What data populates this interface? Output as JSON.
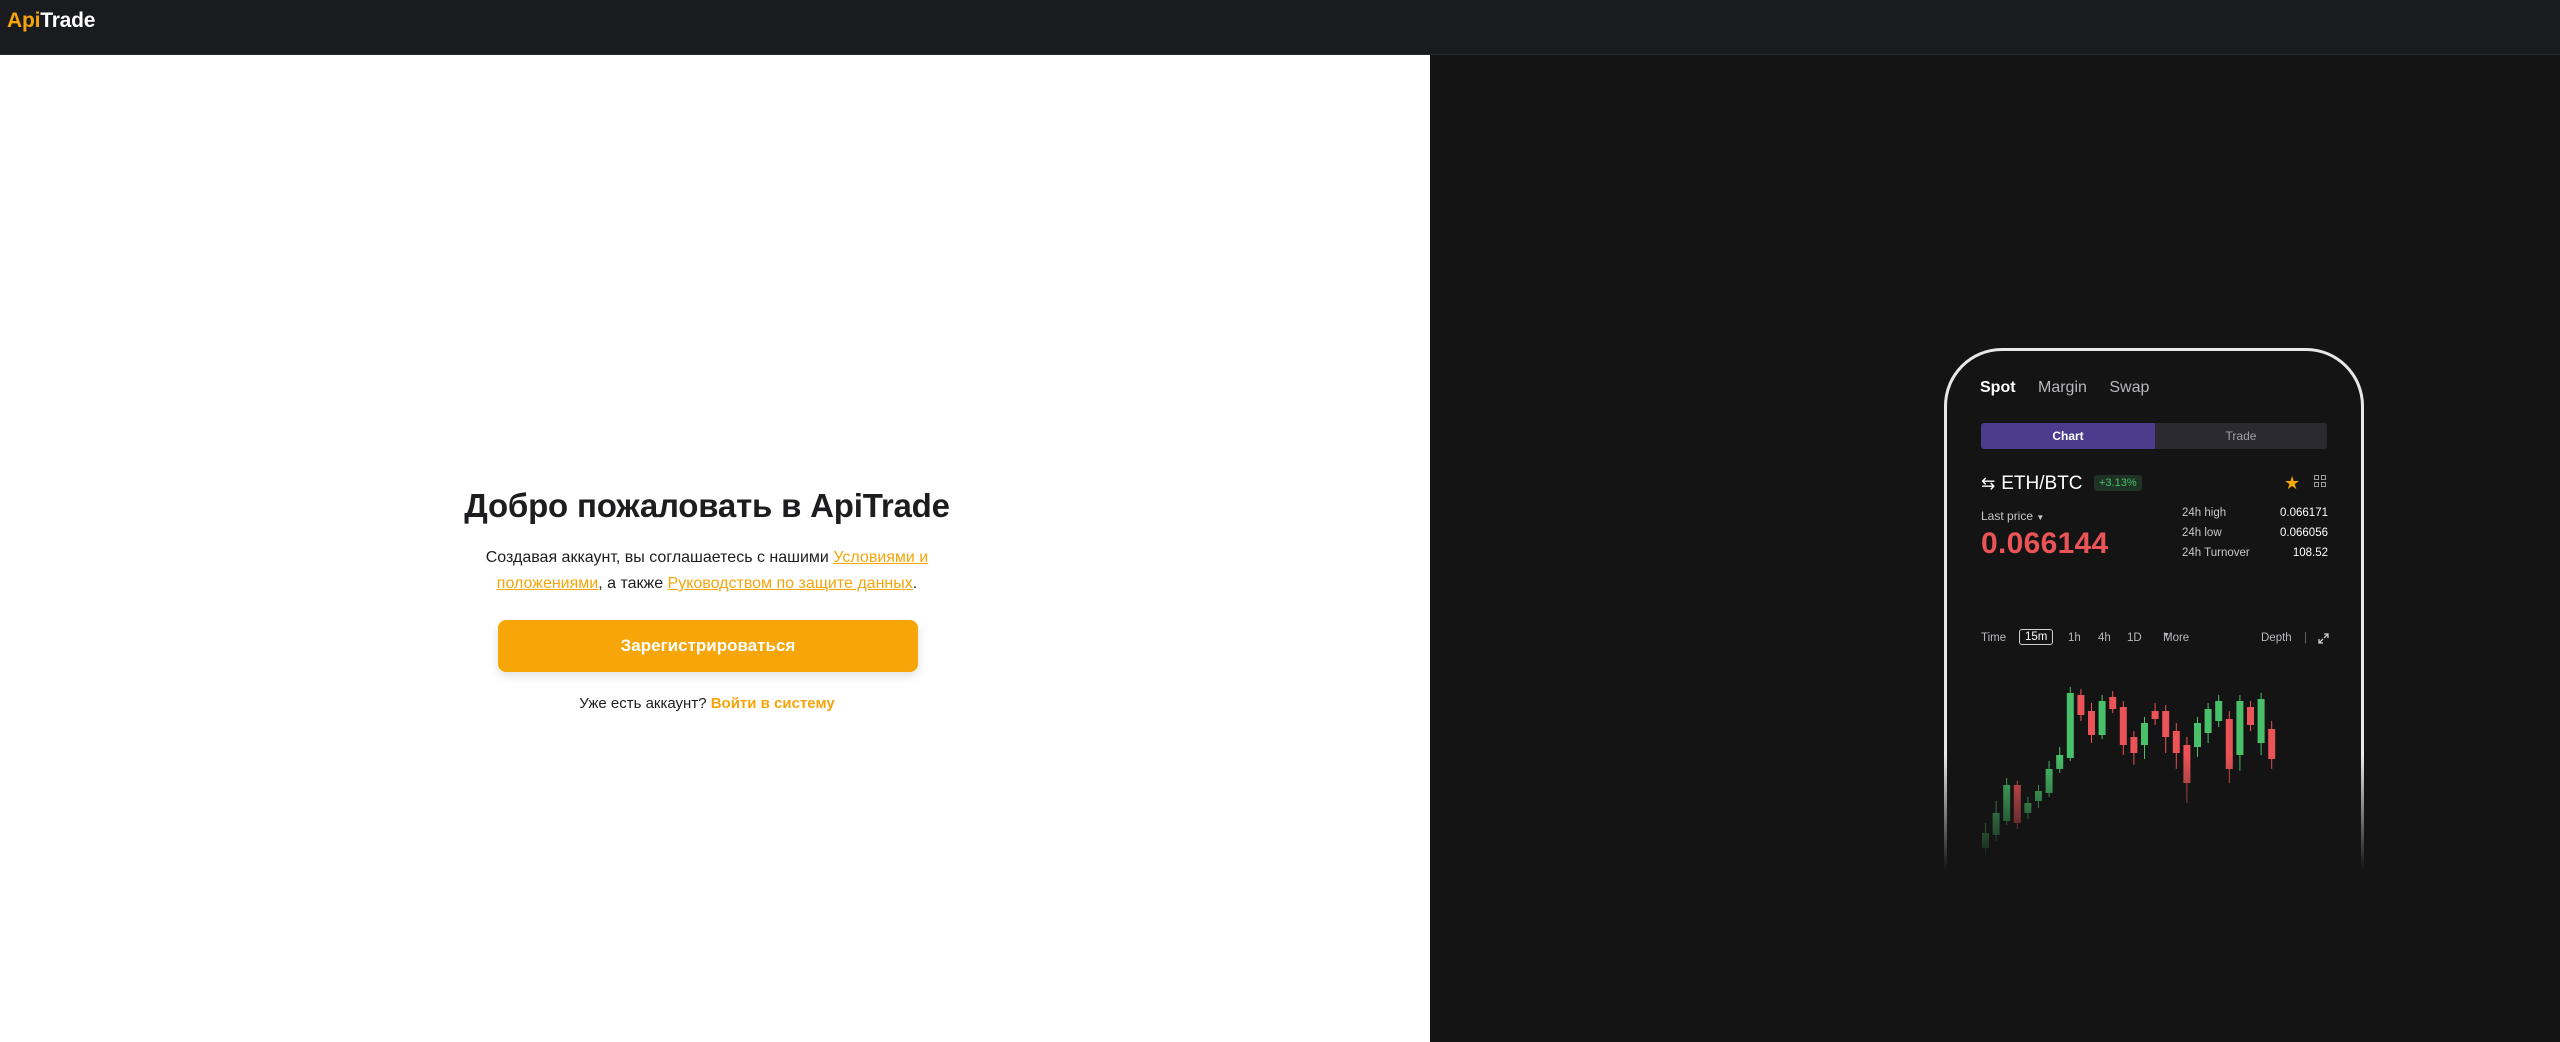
{
  "header": {
    "logo_part1": "Api",
    "logo_part2": "Trade"
  },
  "welcome": {
    "title": "Добро пожаловать в ApiTrade",
    "terms_prefix": "Создавая аккаунт, вы соглашаетесь с нашими ",
    "terms_link": "Условиями и положениями",
    "terms_middle": ", а также ",
    "privacy_link": "Руководством по защите данных",
    "terms_suffix": ".",
    "register_button": "Зарегистрироваться",
    "have_account_text": "Уже есть аккаунт? ",
    "login_link": "Войти в систему"
  },
  "phone": {
    "tabs": [
      "Spot",
      "Margin",
      "Swap"
    ],
    "active_tab": "Spot",
    "segments": [
      "Chart",
      "Trade"
    ],
    "active_segment": "Chart",
    "pair": "ETH/BTC",
    "change": "+3.13%",
    "last_price_label": "Last price",
    "last_price": "0.066144",
    "stats": [
      {
        "label": "24h high",
        "value": "0.066171"
      },
      {
        "label": "24h low",
        "value": "0.066056"
      },
      {
        "label": "24h Turnover",
        "value": "108.52"
      }
    ],
    "timeframes": [
      "Time",
      "15m",
      "1h",
      "4h",
      "1D",
      "More"
    ],
    "active_timeframe": "15m",
    "depth_label": "Depth",
    "colors": {
      "accent": "#f6a609",
      "up": "#49c06a",
      "down": "#ea5456",
      "segment_active": "#4b3c8e"
    }
  }
}
